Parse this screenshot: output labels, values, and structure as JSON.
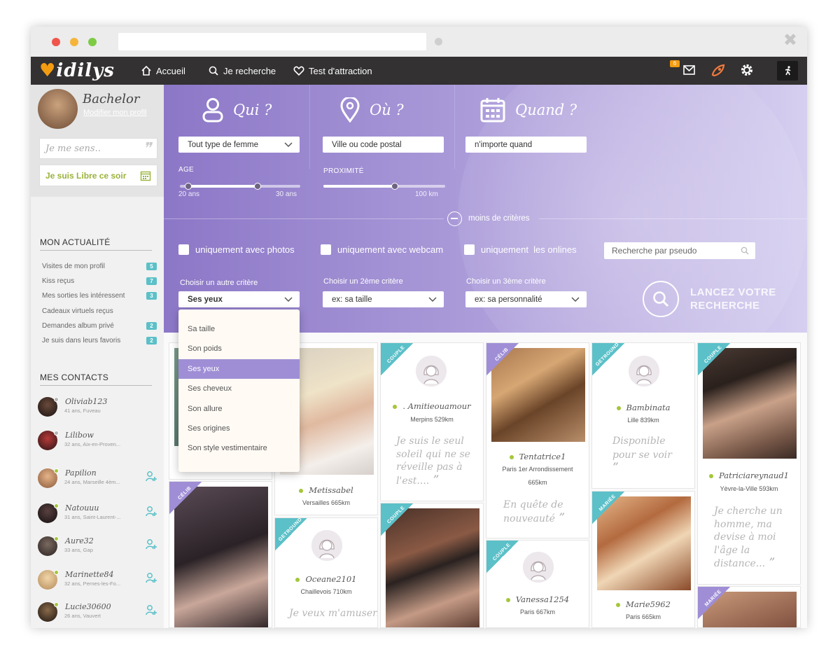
{
  "nav": {
    "logo": "idilys",
    "links": [
      "Accueil",
      "Je recherche",
      "Test d'attraction"
    ],
    "mail_count": "6"
  },
  "profile": {
    "name": "Bachelor",
    "edit_link": "Modifier mon profil",
    "mood_placeholder": "Je me sens..",
    "free_tonight": "Je suis Libre ce soir"
  },
  "activity": {
    "title": "MON ACTUALITÉ",
    "items": [
      {
        "label": "Visites de mon profil",
        "count": "5"
      },
      {
        "label": "Kiss reçus",
        "count": "7"
      },
      {
        "label": "Mes sorties les intéressent",
        "count": "3"
      },
      {
        "label": "Cadeaux virtuels reçus",
        "count": ""
      },
      {
        "label": "Demandes album privé",
        "count": "2"
      },
      {
        "label": "Je suis dans leurs favoris",
        "count": "2"
      }
    ]
  },
  "contacts": {
    "title": "MES CONTACTS",
    "items": [
      {
        "name": "Oliviab123",
        "info": "41 ans, Fuveau"
      },
      {
        "name": "Lilibow",
        "info": "32 ans, Aix-en-Proven..."
      },
      {
        "name": "Papilion",
        "info": "24 ans, Marseille 4èm..."
      },
      {
        "name": "Natouuu",
        "info": "31 ans, Saint-Laurent-..."
      },
      {
        "name": "Aure32",
        "info": "33 ans, Gap"
      },
      {
        "name": "Marinette84",
        "info": "32 ans, Pernes-les-Fo..."
      },
      {
        "name": "Lucie30600",
        "info": "26 ans, Vauvert"
      }
    ]
  },
  "search": {
    "who": {
      "title": "Qui ?",
      "select": "Tout type de femme",
      "age_label": "AGE",
      "age_min": "20 ans",
      "age_max": "30 ans"
    },
    "where": {
      "title": "Où ?",
      "placeholder": "Ville ou code postal",
      "prox_label": "PROXIMITÉ",
      "prox_max": "100 km"
    },
    "when": {
      "title": "Quand ?",
      "select": "n'importe quand"
    },
    "less_criteria": "moins de critères",
    "checkboxes": [
      "uniquement avec photos",
      "uniquement avec webcam",
      "uniquement  les onlines"
    ],
    "pseudo_placeholder": "Recherche par pseudo",
    "criteria": [
      {
        "label": "Choisir un autre critère",
        "value": "Ses yeux"
      },
      {
        "label": "Choisir un 2ème critère",
        "value": "ex: sa taille"
      },
      {
        "label": "Choisir un 3ème critère",
        "value": "ex: sa personnalité"
      }
    ],
    "launch_line1": "LANCEZ VOTRE",
    "launch_line2": "RECHERCHE"
  },
  "dropdown_options": [
    "Sa taille",
    "Son poids",
    "Ses yeux",
    "Ses cheveux",
    "Son allure",
    "Ses origines",
    "Son style vestimentaire"
  ],
  "cards": {
    "metissabel": {
      "name": "Metissabel",
      "loc": "Versailles 665km"
    },
    "oceane": {
      "ribbon": "GETROUND",
      "name": "Oceane2101",
      "loc": "Chaillevois 710km",
      "quote": "Je veux m'amuser...surto"
    },
    "amitie": {
      "ribbon": "COUPLE",
      "name": ". Amitieouamour",
      "loc": "Merpins 529km",
      "quote": "Je suis le seul soleil qui ne se réveille pas à l'est...."
    },
    "couple3": {
      "ribbon": "COUPLE"
    },
    "tentatrice": {
      "ribbon": "CÉLIB",
      "name": "Tentatrice1",
      "loc1": "Paris 1er Arrondissement",
      "loc2": "665km",
      "quote": "En quête de nouveauté"
    },
    "vanessa": {
      "ribbon": "COUPLE",
      "name": "Vanessa1254",
      "loc": "Paris 667km"
    },
    "bambinata": {
      "ribbon": "GETROUND",
      "name": "Bambinata",
      "loc": "Lille 839km",
      "quote": "Disponible pour se voir"
    },
    "marie": {
      "ribbon": "MARIÉE",
      "name": "Marie5962",
      "loc": "Paris 665km"
    },
    "patricia": {
      "ribbon": "COUPLE",
      "name": "Patriciareynaud1",
      "loc": "Yèvre-la-Ville 593km",
      "quote": "Je cherche un homme, ma devise à moi l'âge la distance..."
    },
    "mariee2": {
      "ribbon": "MARIÉE"
    },
    "celib5": {
      "ribbon": "CÉLIB"
    }
  },
  "colors": {
    "accent": "#9f8ed6",
    "badge": "#5bc0c8",
    "online": "#a4c639",
    "brand_orange": "#f39c12"
  }
}
